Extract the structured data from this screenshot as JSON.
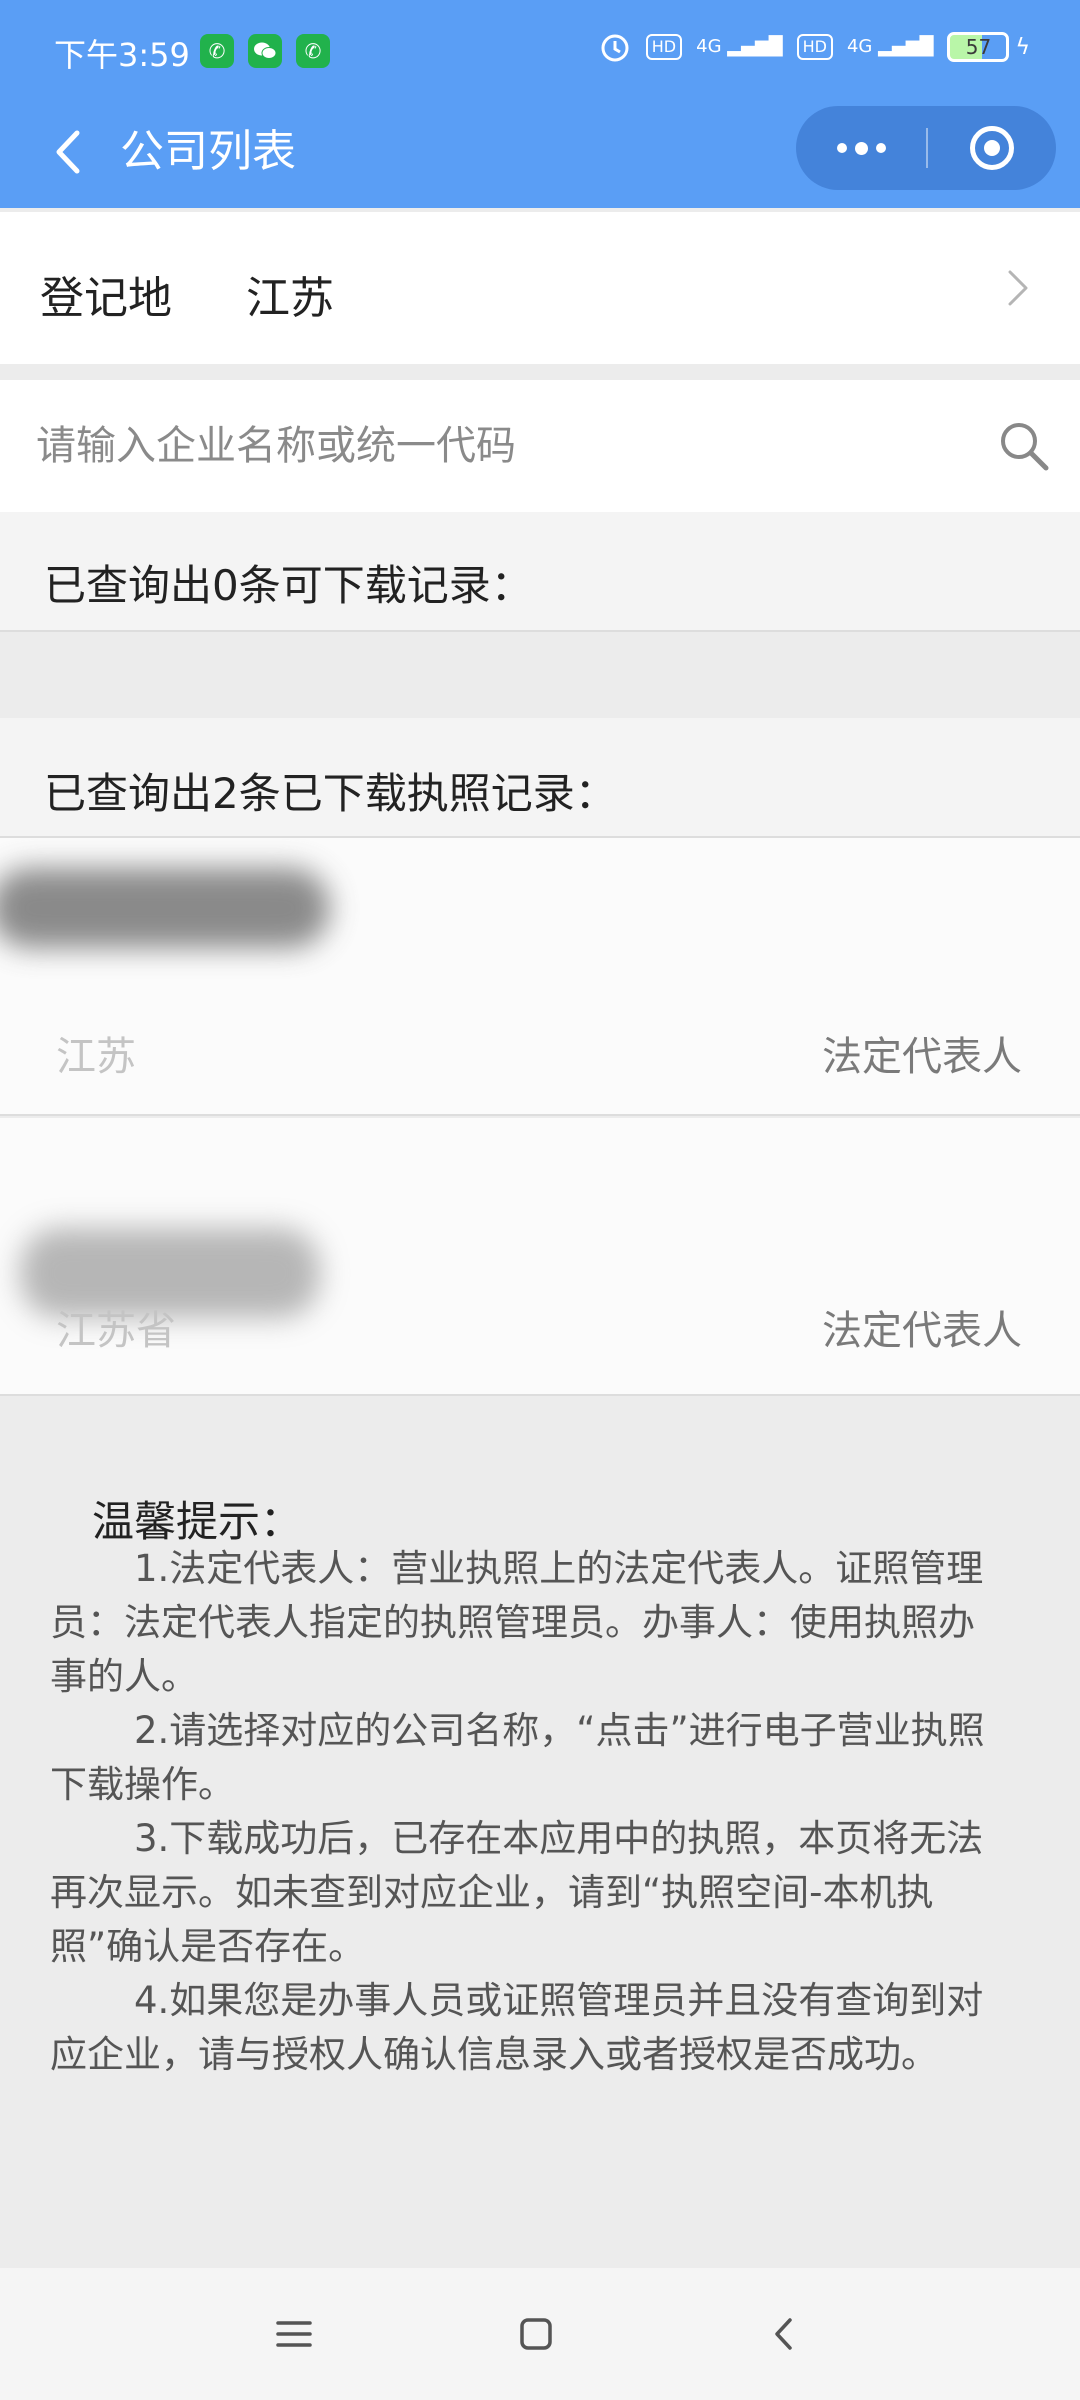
{
  "status_bar": {
    "time": "下午3:59",
    "network_1": "4G",
    "network_2": "4G",
    "hd_1": "HD",
    "hd_2": "HD",
    "battery": "57"
  },
  "nav": {
    "title": "公司列表"
  },
  "region": {
    "label": "登记地",
    "value": "江苏"
  },
  "search": {
    "placeholder": "请输入企业名称或统一代码"
  },
  "downloadable": {
    "title": "已查询出0条可下载记录："
  },
  "downloaded": {
    "title": "已查询出2条已下载执照记录：",
    "records": [
      {
        "province": "江苏",
        "role": "法定代表人"
      },
      {
        "province": "江苏省",
        "role": "法定代表人"
      }
    ]
  },
  "tips": {
    "title": "温馨提示：",
    "items": [
      "1.法定代表人：营业执照上的法定代表人。证照管理员：法定代表人指定的执照管理员。办事人：使用执照办事的人。",
      "2.请选择对应的公司名称，“点击”进行电子营业执照下载操作。",
      "3.下载成功后，已存在本应用中的执照，本页将无法再次显示。如未查到对应企业，请到“执照空间-本机执照”确认是否存在。",
      "4.如果您是办事人员或证照管理员并且没有查询到对应企业，请与授权人确认信息录入或者授权是否成功。"
    ]
  },
  "colors": {
    "header_blue": "#5a9ef5",
    "page_bg": "#ececec"
  }
}
